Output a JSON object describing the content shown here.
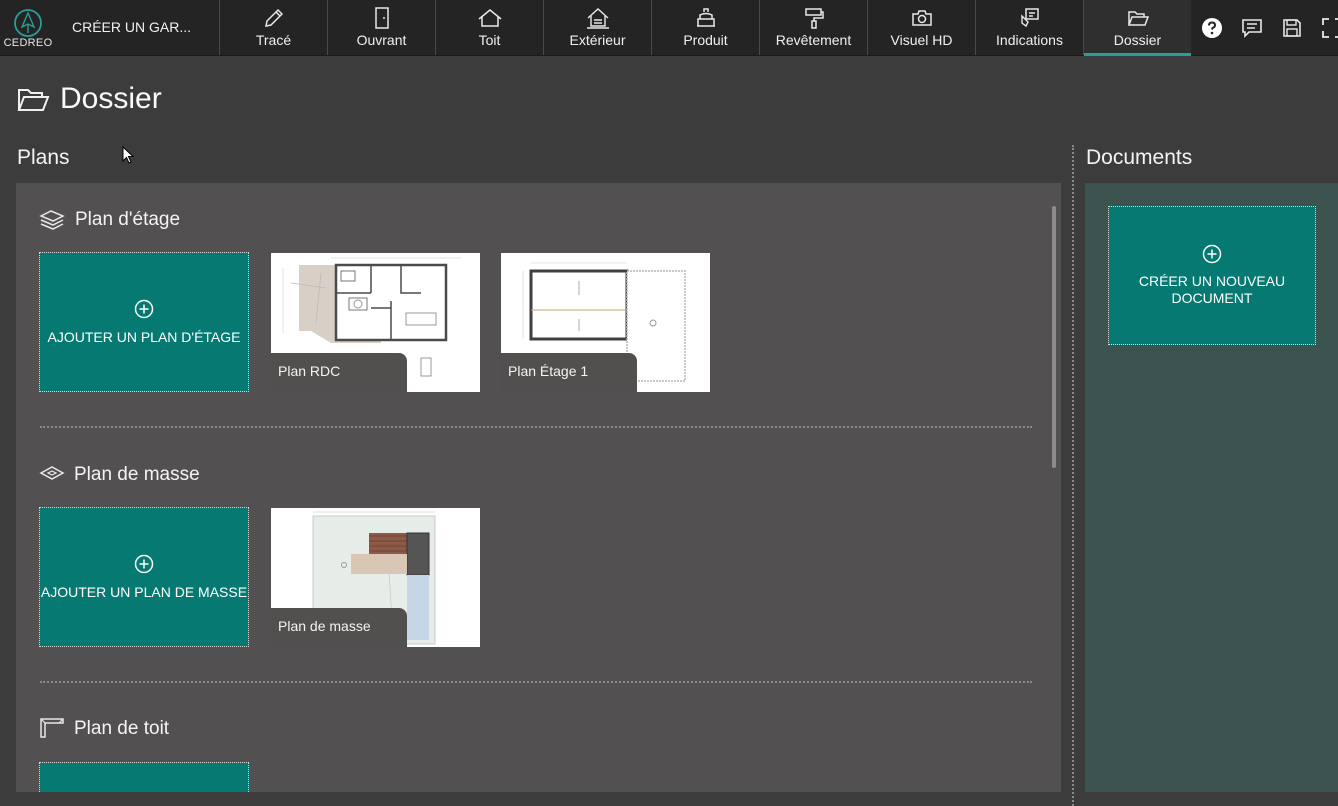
{
  "app": {
    "logo_text": "CEDREO",
    "project_name": "CRÉER UN GAR..."
  },
  "toolbar": {
    "tools": [
      {
        "label": "Tracé",
        "icon": "pencil-icon"
      },
      {
        "label": "Ouvrant",
        "icon": "door-icon"
      },
      {
        "label": "Toit",
        "icon": "roof-icon"
      },
      {
        "label": "Extérieur",
        "icon": "exterior-icon"
      },
      {
        "label": "Produit",
        "icon": "product-icon"
      },
      {
        "label": "Revêtement",
        "icon": "paint-roller-icon"
      },
      {
        "label": "Visuel HD",
        "icon": "camera-icon"
      },
      {
        "label": "Indications",
        "icon": "indications-icon"
      },
      {
        "label": "Dossier",
        "icon": "folder-icon",
        "active": true
      }
    ],
    "right_icons": [
      "help-icon",
      "comment-icon",
      "save-icon",
      "fullscreen-icon"
    ]
  },
  "page": {
    "title": "Dossier",
    "icon": "folder-open-icon"
  },
  "plans": {
    "title": "Plans",
    "categories": [
      {
        "title": "Plan d'étage",
        "icon": "layers-icon",
        "add_label": "AJOUTER UN PLAN D'ÉTAGE",
        "items": [
          {
            "label": "Plan RDC"
          },
          {
            "label": "Plan Étage 1"
          }
        ]
      },
      {
        "title": "Plan de masse",
        "icon": "site-plan-icon",
        "add_label": "AJOUTER UN PLAN DE MASSE",
        "items": [
          {
            "label": "Plan de masse"
          }
        ]
      },
      {
        "title": "Plan de toit",
        "icon": "roof-plan-icon"
      }
    ]
  },
  "documents": {
    "title": "Documents",
    "create_label": "CRÉER UN NOUVEAU DOCUMENT"
  },
  "colors": {
    "accent": "#067a72",
    "active_underline": "#2a9d96",
    "topbar": "#242424",
    "background": "#3c3c3c",
    "panel": "#525050",
    "docs_panel": "#3d5350"
  }
}
